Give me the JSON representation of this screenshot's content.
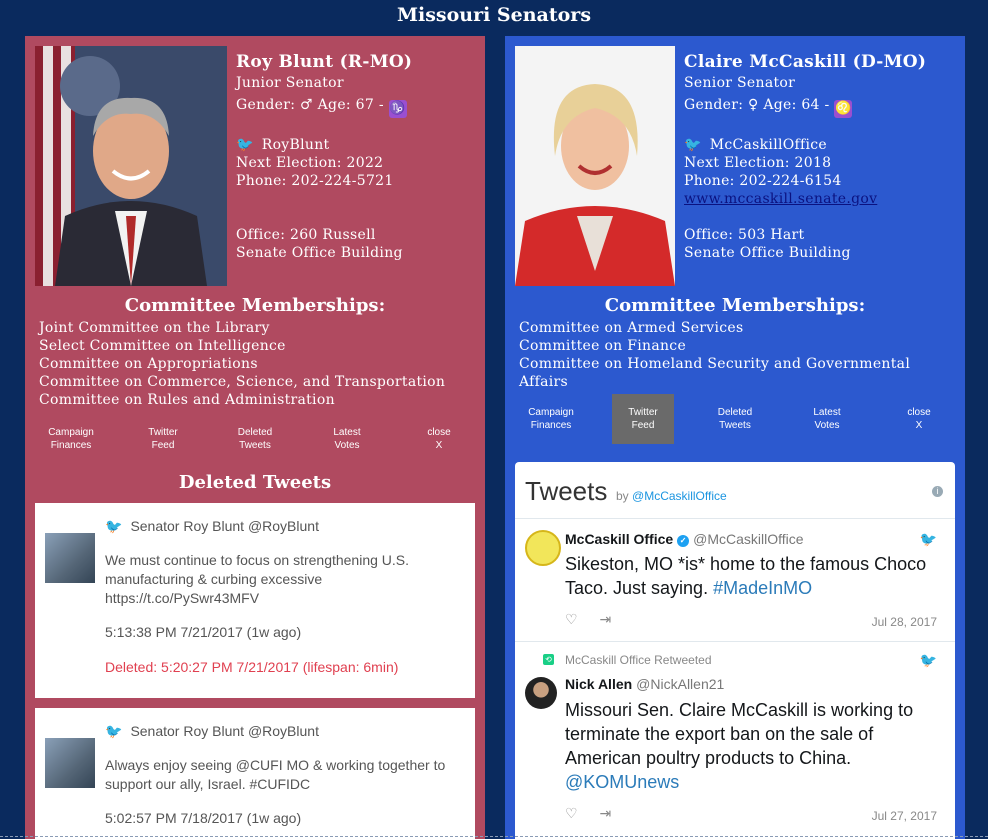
{
  "page_title": "Missouri Senators",
  "colors": {
    "left_panel": "#b04a60",
    "right_panel": "#2c59cf",
    "background": "#0a2a5e"
  },
  "left": {
    "name": "Roy Blunt (R-MO)",
    "rank": "Junior Senator",
    "gender_label": "Gender:",
    "gender_symbol": "♂",
    "age_label": "Age: 67 -",
    "zodiac_symbol": "♑",
    "twitter": "RoyBlunt",
    "next_election": "Next Election: 2022",
    "phone": "Phone: 202-224-5721",
    "office_line1": "Office: 260 Russell",
    "office_line2": "Senate Office Building",
    "committee_heading": "Committee Memberships:",
    "committees": [
      "Joint Committee on the Library",
      "Select Committee on Intelligence",
      "Committee on Appropriations",
      "Committee on Commerce, Science, and Transportation",
      "Committee on Rules and Administration"
    ],
    "tabs": [
      "Campaign\nFinances",
      "Twitter\nFeed",
      "Deleted\nTweets",
      "Latest\nVotes",
      "close\nX"
    ],
    "deleted_heading": "Deleted Tweets",
    "deleted_tweets": [
      {
        "author": "Senator Roy Blunt @RoyBlunt",
        "text": "We must continue to focus on strengthening U.S. manufacturing & curbing excessive https://t.co/PySwr43MFV",
        "time": "5:13:38 PM 7/21/2017 (1w ago)",
        "deleted": "Deleted: 5:20:27 PM 7/21/2017 (lifespan: 6min)"
      },
      {
        "author": "Senator Roy Blunt @RoyBlunt",
        "text": "Always enjoy seeing @CUFI MO & working together to support our ally, Israel. #CUFIDC",
        "time": "5:02:57 PM 7/18/2017 (1w ago)"
      }
    ]
  },
  "right": {
    "name": "Claire McCaskill (D-MO)",
    "rank": "Senior Senator",
    "gender_label": "Gender:",
    "gender_symbol": "♀",
    "age_label": "Age: 64 -",
    "zodiac_symbol": "♌",
    "twitter": "McCaskillOffice",
    "next_election": "Next Election: 2018",
    "phone": "Phone: 202-224-6154",
    "website": "www.mccaskill.senate.gov",
    "office_line1": "Office: 503 Hart",
    "office_line2": "Senate Office Building",
    "committee_heading": "Committee Memberships:",
    "committees": [
      "Committee on Armed Services",
      "Committee on Finance",
      "Committee on Homeland Security and Governmental Affairs"
    ],
    "tabs": [
      "Campaign\nFinances",
      "Twitter\nFeed",
      "Deleted\nTweets",
      "Latest\nVotes",
      "close\nX"
    ],
    "active_tab": "Twitter\nFeed",
    "widget": {
      "title": "Tweets",
      "by_label": "by",
      "by_handle": "@McCaskillOffice",
      "tweets": [
        {
          "name": "McCaskill Office",
          "handle": "@McCaskillOffice",
          "text_before": "Sikeston, MO *is* home to the famous Choco Taco. Just saying. ",
          "text_highlight": "#MadeInMO",
          "date": "Jul 28, 2017"
        },
        {
          "retweeted_by": "McCaskill Office Retweeted",
          "name": "Nick Allen",
          "handle": "@NickAllen21",
          "text_before": "Missouri Sen. Claire McCaskill is working to terminate the export ban on the sale of American poultry products to China. ",
          "text_highlight": "@KOMUnews",
          "date": "Jul 27, 2017"
        }
      ]
    }
  }
}
